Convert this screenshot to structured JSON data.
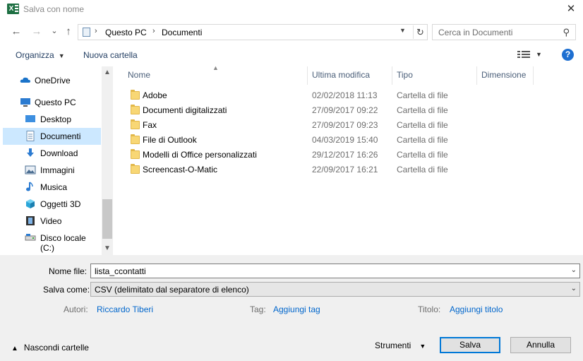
{
  "window": {
    "title": "Salva con nome",
    "close_glyph": "✕"
  },
  "nav_buttons": {
    "back": "←",
    "forward": "→",
    "up": "↑",
    "recent": "⌄"
  },
  "address": {
    "crumbs": [
      "Questo PC",
      "Documenti"
    ],
    "separator": "›"
  },
  "search": {
    "placeholder": "Cerca in Documenti"
  },
  "toolbar": {
    "organize": "Organizza",
    "new_folder": "Nuova cartella"
  },
  "sidebar": {
    "items": [
      {
        "label": "OneDrive",
        "icon": "cloud-icon"
      },
      {
        "label": "Questo PC",
        "icon": "computer-icon"
      },
      {
        "label": "Desktop",
        "icon": "desktop-icon"
      },
      {
        "label": "Documenti",
        "icon": "document-icon",
        "selected": true
      },
      {
        "label": "Download",
        "icon": "download-icon"
      },
      {
        "label": "Immagini",
        "icon": "pictures-icon"
      },
      {
        "label": "Musica",
        "icon": "music-icon"
      },
      {
        "label": "Oggetti 3D",
        "icon": "cube-icon"
      },
      {
        "label": "Video",
        "icon": "video-icon"
      },
      {
        "label": "Disco locale (C:)",
        "icon": "drive-icon"
      }
    ]
  },
  "file_list": {
    "columns": [
      "Nome",
      "Ultima modifica",
      "Tipo",
      "Dimensione"
    ],
    "rows": [
      {
        "name": "Adobe",
        "modified": "02/02/2018 11:13",
        "type": "Cartella di file"
      },
      {
        "name": "Documenti digitalizzati",
        "modified": "27/09/2017 09:22",
        "type": "Cartella di file"
      },
      {
        "name": "Fax",
        "modified": "27/09/2017 09:23",
        "type": "Cartella di file"
      },
      {
        "name": "File di Outlook",
        "modified": "04/03/2019 15:40",
        "type": "Cartella di file"
      },
      {
        "name": "Modelli di Office personalizzati",
        "modified": "29/12/2017 16:26",
        "type": "Cartella di file"
      },
      {
        "name": "Screencast-O-Matic",
        "modified": "22/09/2017 16:21",
        "type": "Cartella di file"
      }
    ]
  },
  "form": {
    "filename_label": "Nome file:",
    "filename_value": "lista_ccontatti",
    "savetype_label": "Salva come:",
    "savetype_value": "CSV (delimitato dal separatore di elenco)",
    "authors_label": "Autori:",
    "authors_value": "Riccardo Tiberi",
    "tags_label": "Tag:",
    "tags_value": "Aggiungi tag",
    "title_label": "Titolo:",
    "title_value": "Aggiungi titolo"
  },
  "footer": {
    "hide_folders": "Nascondi cartelle",
    "tools": "Strumenti",
    "save": "Salva",
    "cancel": "Annulla"
  },
  "colors": {
    "selection": "#cce8ff",
    "accent": "#0078d7",
    "link": "#0066cc",
    "folder": "#f8d775"
  }
}
